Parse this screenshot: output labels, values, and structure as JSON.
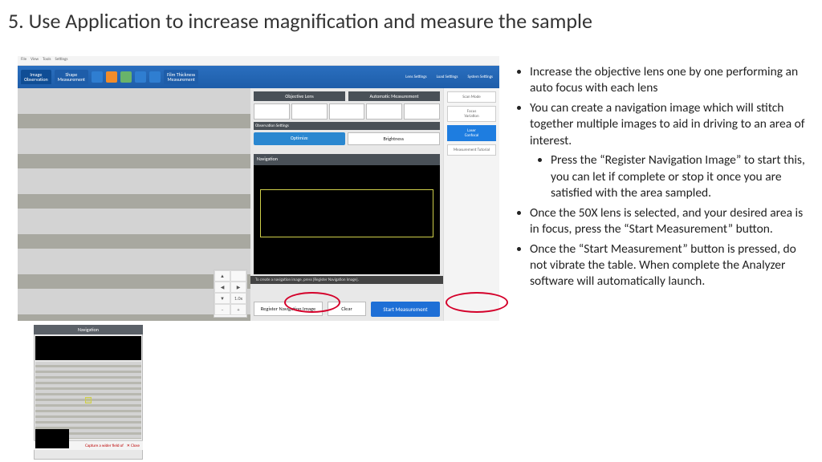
{
  "title": "5. Use Application to increase magnification and measure the sample",
  "menubar": [
    "File",
    "View",
    "Tools",
    "Settings"
  ],
  "ribbon": {
    "tab_image": "Image\nObservation",
    "tab_shape": "Shape\nMeasurement",
    "tab_film": "Film Thickness\nMeasurement",
    "right1": "Lens Settings",
    "right2": "Load Settings",
    "right3": "System Settings"
  },
  "panel": {
    "hdr_objective": "Objective Lens",
    "hdr_auto": "Automatic Measurement",
    "obs_label": "Observation Settings",
    "btn_optimize": "Optimize",
    "btn_brightness": "Brightness",
    "nav_label": "Navigation",
    "nav_hint": "To create a navigation image, press [Register Navigation Image].",
    "btn_register": "Register Navigation Image",
    "btn_clear": "Clear",
    "btn_start": "Start Measurement",
    "zoom_value": "1.0x"
  },
  "rail": {
    "mode": "Scan Mode",
    "focus": "Focus\nVariation",
    "laser": "Laser\nConfocal",
    "tutorial": "Measurement Tutorial"
  },
  "inset": {
    "title": "Navigation",
    "foot_cap": "Capture a wider field of",
    "foot_close": "✕ Close"
  },
  "instr": {
    "b1": "Increase the objective lens one by one performing an auto focus with each lens",
    "b2": "You can create a navigation image which will stitch together multiple images to aid in driving to an area of interest.",
    "b2a": "Press the “Register Navigation Image” to start this, you can let if complete or stop it once you are satisfied with the area sampled.",
    "b3": "Once the 50X lens is selected, and your desired area is in focus, press the “Start Measurement” button.",
    "b4": "Once the “Start Measurement” button is pressed, do not vibrate the table.  When complete the Analyzer software will automatically launch."
  }
}
